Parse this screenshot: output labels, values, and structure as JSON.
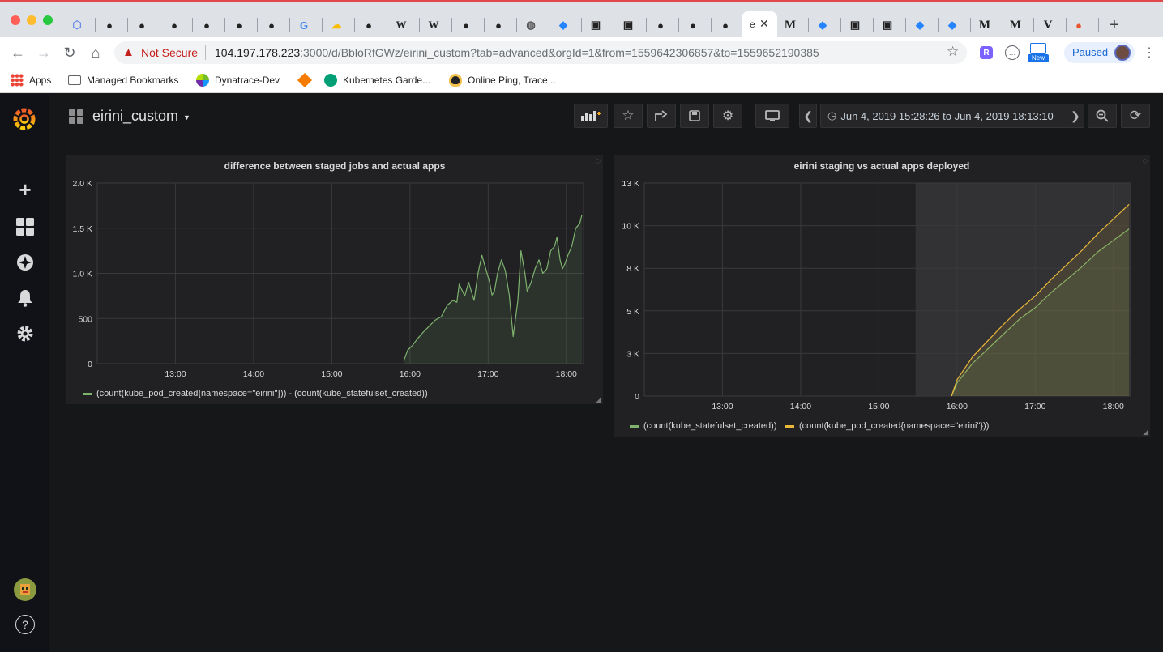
{
  "browser": {
    "active_tab_glyph": "e",
    "url_warning": "Not Secure",
    "url_host": "104.197.178.223",
    "url_path": ":3000/d/BbloRfGWz/eirini_custom?tab=advanced&orgId=1&from=1559642306857&to=1559652190385",
    "paused_label": "Paused",
    "new_badge": "New",
    "bookmarks": [
      "Apps",
      "Managed Bookmarks",
      "Dynatrace-Dev",
      "Kubernetes Garde...",
      "Online Ping, Trace..."
    ]
  },
  "dashboard": {
    "title": "eirini_custom",
    "time_range": "Jun 4, 2019 15:28:26 to Jun 4, 2019 18:13:10"
  },
  "colors": {
    "green": "#7eb26d",
    "yellow": "#eab839",
    "background": "#161719",
    "panel": "#212124"
  },
  "chart_data": [
    {
      "type": "area",
      "title": "difference between staged jobs and actual apps",
      "x_ticks": [
        "13:00",
        "14:00",
        "15:00",
        "16:00",
        "17:00",
        "18:00"
      ],
      "y_ticks": [
        "0",
        "500",
        "1.0 K",
        "1.5 K",
        "2.0 K"
      ],
      "ylim": [
        0,
        2000
      ],
      "xlim_hours": [
        12.0,
        18.22
      ],
      "grid": true,
      "legend_position": "bottom-left",
      "series": [
        {
          "name": "(count(kube_pod_created{namespace=\"eirini\"})) - (count(kube_statefulset_created))",
          "color": "#7eb26d",
          "x": [
            15.92,
            15.97,
            16.03,
            16.1,
            16.17,
            16.25,
            16.32,
            16.4,
            16.48,
            16.55,
            16.6,
            16.63,
            16.7,
            16.75,
            16.82,
            16.87,
            16.92,
            16.97,
            17.02,
            17.05,
            17.08,
            17.12,
            17.17,
            17.22,
            17.27,
            17.32,
            17.35,
            17.38,
            17.42,
            17.47,
            17.5,
            17.55,
            17.6,
            17.65,
            17.7,
            17.75,
            17.8,
            17.85,
            17.88,
            17.92,
            17.95,
            17.98,
            18.02,
            18.07,
            18.12,
            18.17,
            18.2
          ],
          "y": [
            30,
            150,
            200,
            280,
            350,
            420,
            480,
            520,
            650,
            700,
            680,
            880,
            750,
            900,
            700,
            1000,
            1200,
            1050,
            900,
            760,
            800,
            1000,
            1150,
            1030,
            760,
            300,
            500,
            700,
            1250,
            1000,
            800,
            900,
            1050,
            1150,
            1000,
            1050,
            1250,
            1300,
            1400,
            1150,
            1050,
            1100,
            1200,
            1300,
            1500,
            1550,
            1650
          ]
        }
      ]
    },
    {
      "type": "area",
      "title": "eirini staging vs actual apps deployed",
      "x_ticks": [
        "13:00",
        "14:00",
        "15:00",
        "16:00",
        "17:00",
        "18:00"
      ],
      "y_ticks": [
        "0",
        "3 K",
        "5 K",
        "8 K",
        "10 K",
        "13 K"
      ],
      "ylim": [
        0,
        13000
      ],
      "xlim_hours": [
        12.0,
        18.22
      ],
      "highlighted_range_hours": [
        15.47,
        18.22
      ],
      "grid": true,
      "legend_position": "bottom-left",
      "series": [
        {
          "name": "(count(kube_statefulset_created))",
          "color": "#7eb26d",
          "x": [
            15.93,
            16.0,
            16.2,
            16.4,
            16.6,
            16.8,
            17.0,
            17.2,
            17.4,
            17.6,
            17.8,
            18.0,
            18.2
          ],
          "y": [
            0,
            800,
            2000,
            2900,
            3800,
            4700,
            5400,
            6300,
            7100,
            7900,
            8800,
            9500,
            10200
          ]
        },
        {
          "name": "(count(kube_pod_created{namespace=\"eirini\"}))",
          "color": "#eab839",
          "x": [
            15.93,
            16.0,
            16.2,
            16.4,
            16.6,
            16.8,
            17.0,
            17.2,
            17.4,
            17.6,
            17.8,
            18.0,
            18.2
          ],
          "y": [
            0,
            1000,
            2400,
            3400,
            4400,
            5300,
            6100,
            7100,
            8000,
            8900,
            9900,
            10800,
            11700
          ]
        }
      ]
    }
  ]
}
